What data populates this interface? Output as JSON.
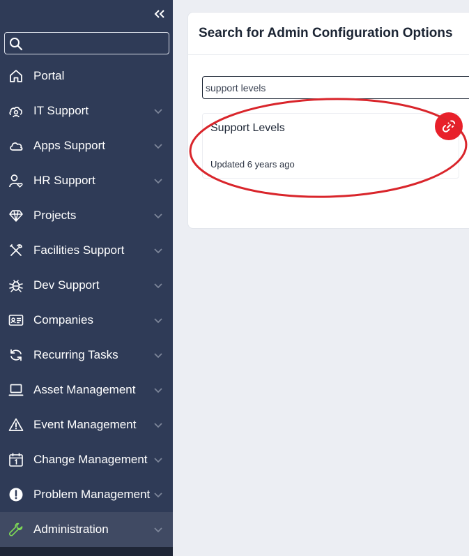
{
  "sidebar": {
    "search": {
      "value": "",
      "placeholder": ""
    },
    "items": [
      {
        "label": "Portal",
        "icon": "home-icon",
        "has_chevron": false
      },
      {
        "label": "IT Support",
        "icon": "it-support-icon",
        "has_chevron": true
      },
      {
        "label": "Apps Support",
        "icon": "cloud-icon",
        "has_chevron": true
      },
      {
        "label": "HR Support",
        "icon": "hr-person-icon",
        "has_chevron": true
      },
      {
        "label": "Projects",
        "icon": "diamond-icon",
        "has_chevron": true
      },
      {
        "label": "Facilities Support",
        "icon": "tools-icon",
        "has_chevron": true
      },
      {
        "label": "Dev Support",
        "icon": "bug-icon",
        "has_chevron": true
      },
      {
        "label": "Companies",
        "icon": "id-card-icon",
        "has_chevron": true
      },
      {
        "label": "Recurring Tasks",
        "icon": "refresh-icon",
        "has_chevron": true
      },
      {
        "label": "Asset Management",
        "icon": "laptop-icon",
        "has_chevron": true
      },
      {
        "label": "Event Management",
        "icon": "warning-icon",
        "has_chevron": true
      },
      {
        "label": "Change Management",
        "icon": "calendar-icon",
        "has_chevron": true
      },
      {
        "label": "Problem Management",
        "icon": "exclamation-circle-icon",
        "has_chevron": true
      },
      {
        "label": "Administration",
        "icon": "wrench-icon",
        "has_chevron": true,
        "active": true
      }
    ]
  },
  "main": {
    "title": "Search for Admin Configuration Options",
    "search": {
      "value": "support levels"
    },
    "results": [
      {
        "title": "Support Levels",
        "updated": "Updated 6 years ago",
        "badge_icon": "link-icon"
      }
    ]
  },
  "colors": {
    "sidebar_bg": "#2f3b57",
    "sidebar_active_bg": "#404a63",
    "active_icon": "#7ed957",
    "badge_red": "#e8202a",
    "annotation_red": "#d9252b"
  }
}
